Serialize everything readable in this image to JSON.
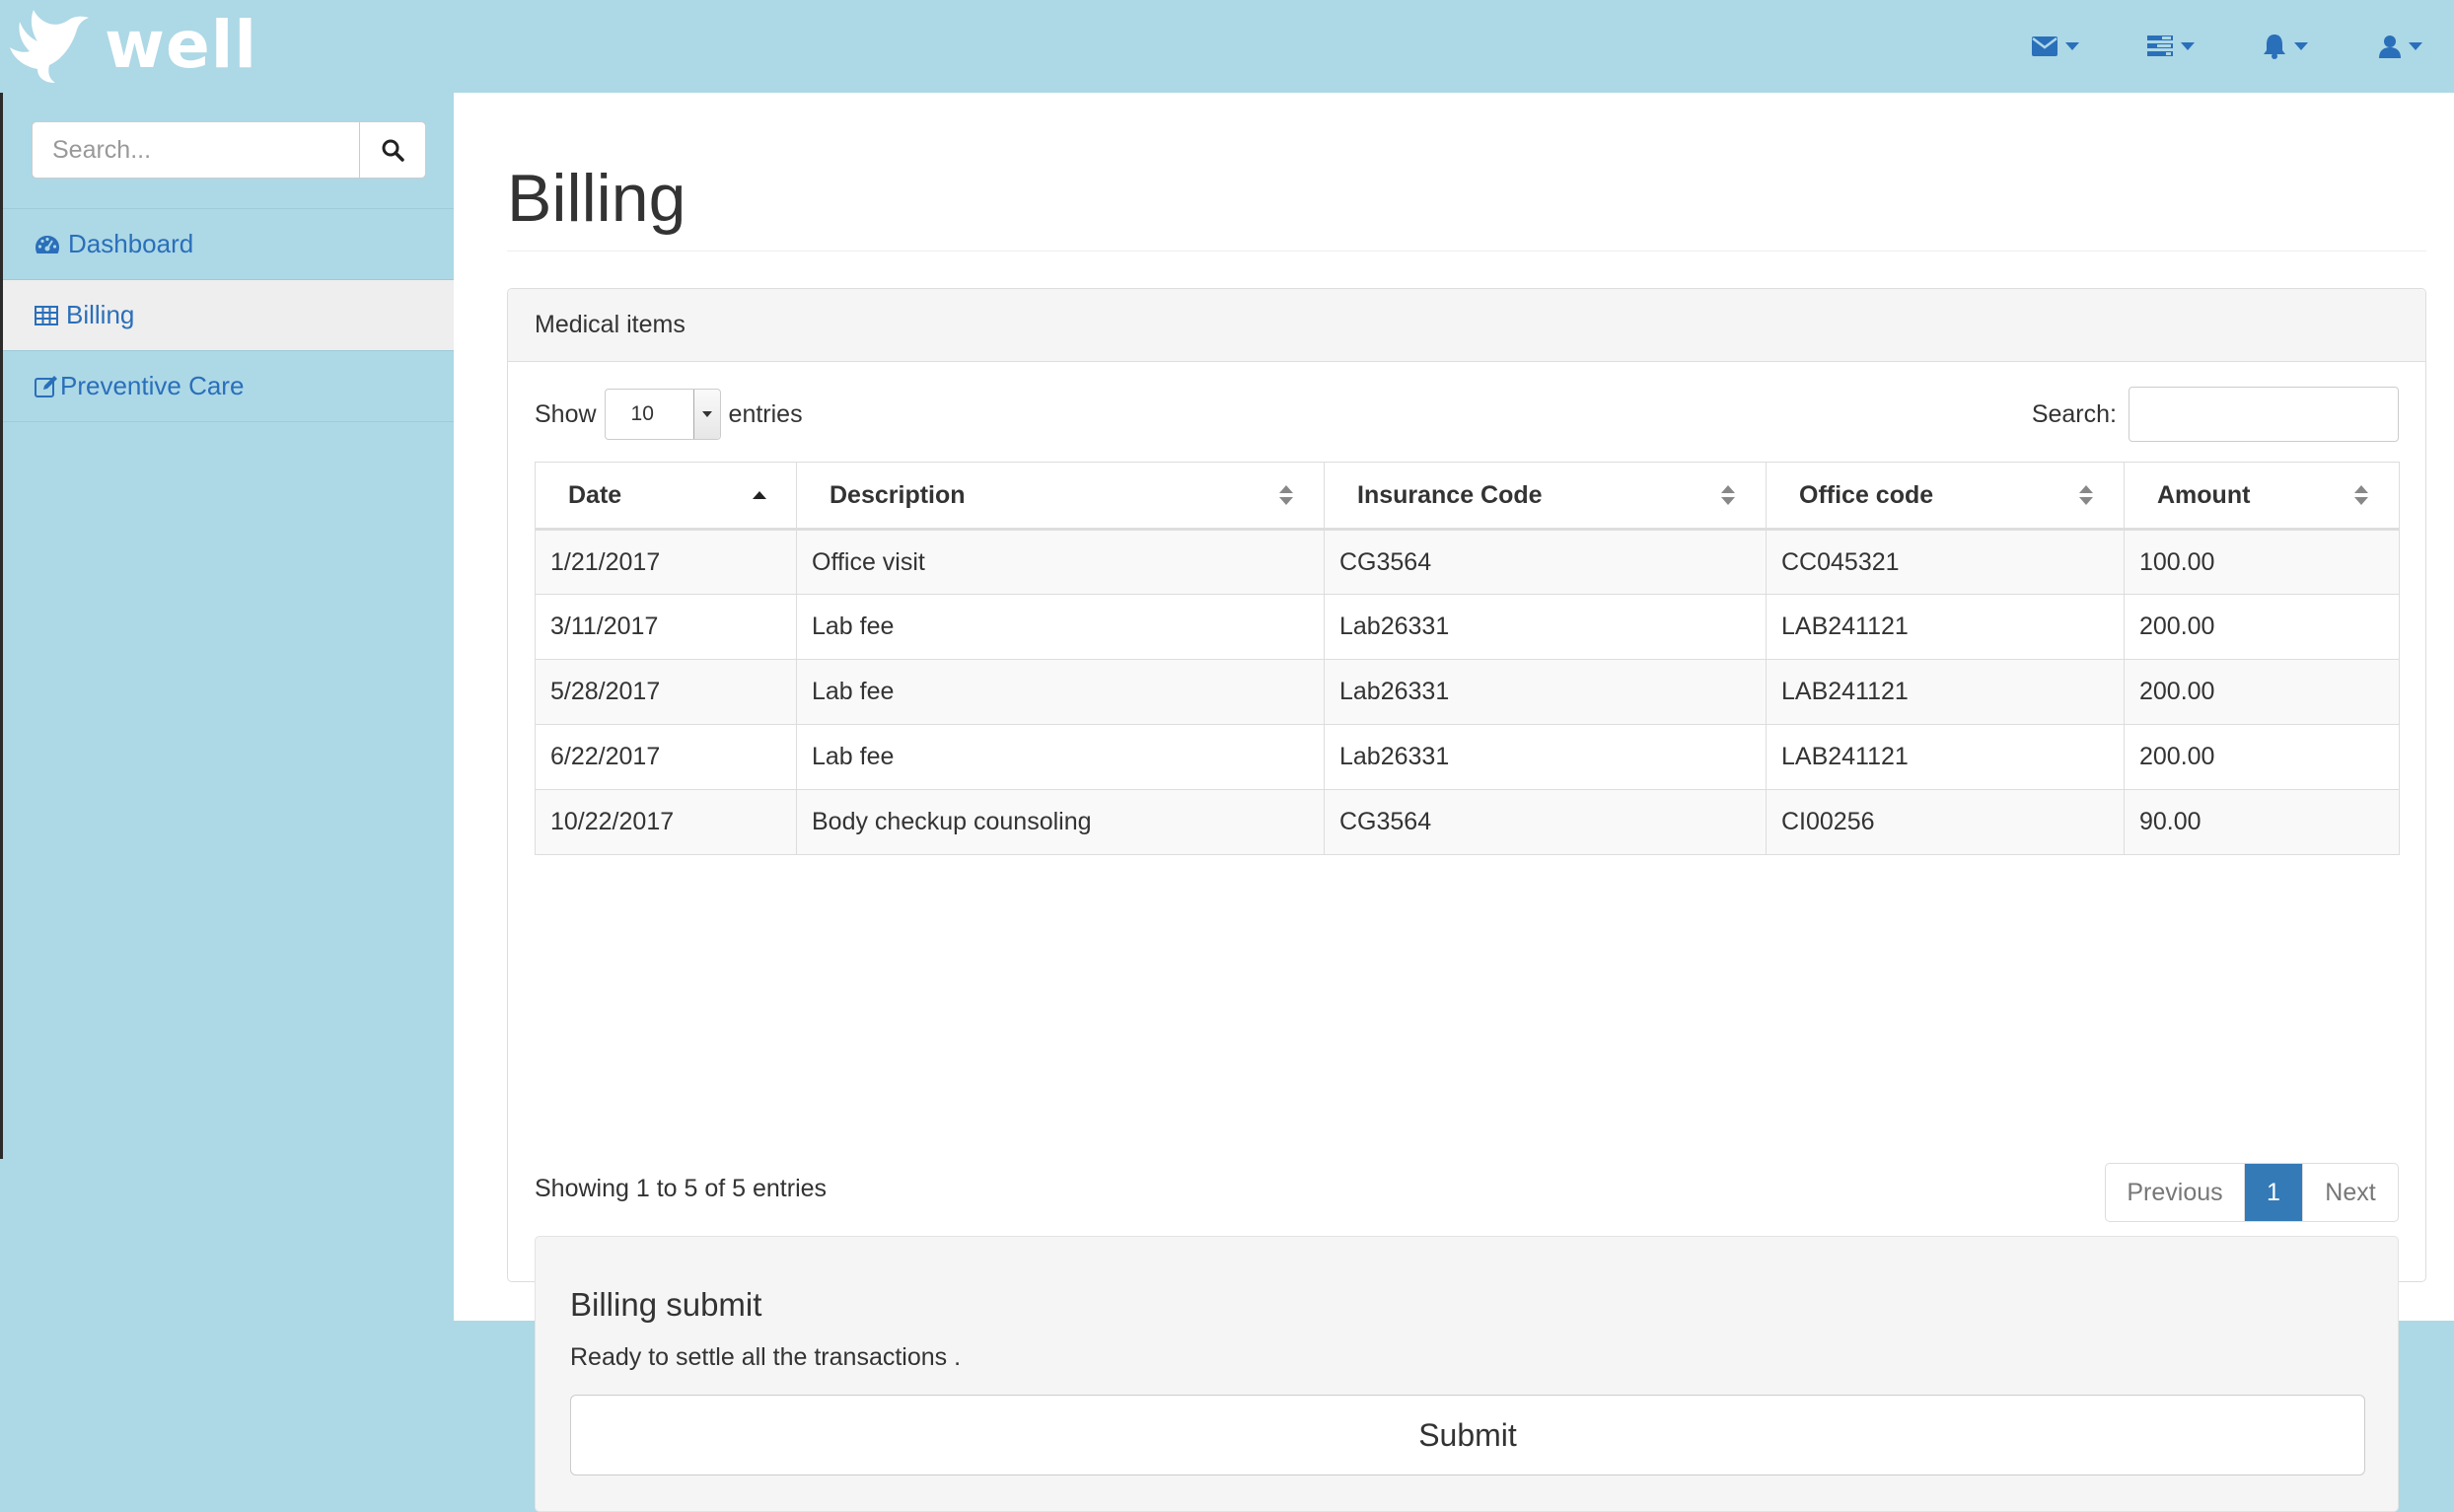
{
  "app": {
    "brand": "well",
    "accent_color": "#add8e6",
    "link_color": "#2a6fba",
    "primary_color": "#337ab7"
  },
  "navbar": {
    "icons": [
      "envelope-icon",
      "tasks-icon",
      "bell-icon",
      "user-icon"
    ]
  },
  "sidebar": {
    "search": {
      "placeholder": "Search...",
      "value": ""
    },
    "items": [
      {
        "label": "Dashboard",
        "icon": "dashboard-icon",
        "active": false
      },
      {
        "label": "Billing",
        "icon": "table-icon",
        "active": true
      },
      {
        "label": "Preventive Care",
        "icon": "edit-icon",
        "active": false
      }
    ]
  },
  "main": {
    "title": "Billing",
    "panel_title": "Medical items",
    "length": {
      "show_label": "Show",
      "value": "10",
      "entries_label": "entries"
    },
    "filter": {
      "label": "Search:",
      "value": ""
    },
    "table": {
      "columns": [
        "Date",
        "Description",
        "Insurance Code",
        "Office code",
        "Amount"
      ],
      "sorted_column": "Date",
      "sort_direction": "ascending",
      "rows": [
        [
          "1/21/2017",
          "Office visit",
          "CG3564",
          "CC045321",
          "100.00"
        ],
        [
          "3/11/2017",
          "Lab fee",
          "Lab26331",
          "LAB241121",
          "200.00"
        ],
        [
          "5/28/2017",
          "Lab fee",
          "Lab26331",
          "LAB241121",
          "200.00"
        ],
        [
          "6/22/2017",
          "Lab fee",
          "Lab26331",
          "LAB241121",
          "200.00"
        ],
        [
          "10/22/2017",
          "Body checkup counsoling",
          "CG3564",
          "CI00256",
          "90.00"
        ]
      ]
    },
    "info": "Showing 1 to 5 of 5 entries",
    "pagination": {
      "previous": "Previous",
      "current": "1",
      "next": "Next"
    },
    "billing_submit": {
      "heading": "Billing submit",
      "text": "Ready to settle all the transactions .",
      "button": "Submit"
    }
  }
}
